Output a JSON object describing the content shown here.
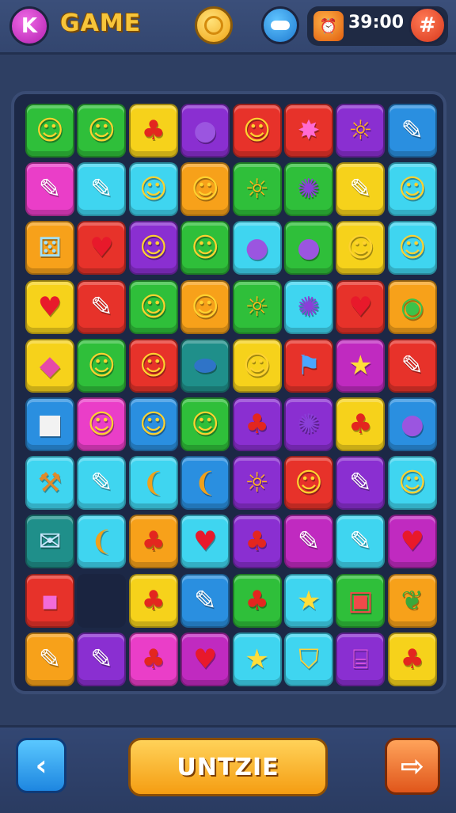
{
  "header": {
    "menu_glyph": "K",
    "title": "GAME",
    "timer": "39:00",
    "grid_glyph": "#",
    "clock_glyph": "⏰",
    "icons": [
      "k-menu-icon",
      "coin-icon",
      "toggle-icon",
      "clock-icon",
      "grid-icon"
    ]
  },
  "footer": {
    "back_glyph": "‹",
    "action_label": "UNTZIE",
    "next_glyph": "⇨"
  },
  "colors": {
    "green": "#2fbf3a",
    "yellow": "#f6d21b",
    "purple": "#8a2fd1",
    "red": "#e7322a",
    "cyan": "#3fd5f0",
    "orange": "#f7a11a",
    "pink": "#ea3ec8",
    "blue": "#2a8fe0",
    "teal": "#1f8f8a",
    "magenta": "#c02ac0"
  },
  "board": {
    "rows": [
      [
        [
          "green",
          "smiley"
        ],
        [
          "green",
          "smiley"
        ],
        [
          "yellow",
          "lollipop"
        ],
        [
          "purple",
          "balloon"
        ],
        [
          "red",
          "smiley"
        ],
        [
          "red",
          "burst"
        ],
        [
          "purple",
          "sun"
        ],
        [
          "blue",
          "pencil"
        ]
      ],
      [
        [
          "pink",
          "pencil"
        ],
        [
          "cyan",
          "pencil"
        ],
        [
          "cyan",
          "smiley"
        ],
        [
          "orange",
          "smiley"
        ],
        [
          "green",
          "sun"
        ],
        [
          "green",
          "monster"
        ],
        [
          "yellow",
          "pencil"
        ],
        [
          "cyan",
          "smiley"
        ]
      ],
      [
        [
          "orange",
          "dice"
        ],
        [
          "red",
          "heart"
        ],
        [
          "purple",
          "smiley"
        ],
        [
          "green",
          "smiley"
        ],
        [
          "cyan",
          "balloon"
        ],
        [
          "green",
          "balloon"
        ],
        [
          "yellow",
          "smiley"
        ],
        [
          "cyan",
          "smiley"
        ]
      ],
      [
        [
          "yellow",
          "heart"
        ],
        [
          "red",
          "pencil"
        ],
        [
          "green",
          "smiley"
        ],
        [
          "orange",
          "smiley"
        ],
        [
          "green",
          "sun"
        ],
        [
          "cyan",
          "monster"
        ],
        [
          "red",
          "heart"
        ],
        [
          "orange",
          "blob"
        ]
      ],
      [
        [
          "yellow",
          "kite"
        ],
        [
          "green",
          "smiley"
        ],
        [
          "red",
          "smiley"
        ],
        [
          "teal",
          "ball"
        ],
        [
          "yellow",
          "smiley"
        ],
        [
          "red",
          "flag"
        ],
        [
          "magenta",
          "star"
        ],
        [
          "red",
          "pencil"
        ]
      ],
      [
        [
          "blue",
          "cube"
        ],
        [
          "pink",
          "smiley"
        ],
        [
          "blue",
          "smiley"
        ],
        [
          "green",
          "smiley"
        ],
        [
          "purple",
          "lollipop"
        ],
        [
          "purple",
          "monster"
        ],
        [
          "yellow",
          "lollipop"
        ],
        [
          "blue",
          "balloon"
        ]
      ],
      [
        [
          "cyan",
          "hammer"
        ],
        [
          "cyan",
          "pencil"
        ],
        [
          "cyan",
          "bean"
        ],
        [
          "blue",
          "bean"
        ],
        [
          "purple",
          "sun"
        ],
        [
          "red",
          "smiley"
        ],
        [
          "purple",
          "pencil"
        ],
        [
          "cyan",
          "smiley"
        ]
      ],
      [
        [
          "teal",
          "envelope"
        ],
        [
          "cyan",
          "bean"
        ],
        [
          "orange",
          "lollipop"
        ],
        [
          "cyan",
          "heart"
        ],
        [
          "purple",
          "lollipop"
        ],
        [
          "magenta",
          "pencil"
        ],
        [
          "cyan",
          "pencil"
        ],
        [
          "magenta",
          "heart"
        ]
      ],
      [
        [
          "red",
          "square"
        ],
        [
          "empty",
          "empty"
        ],
        [
          "yellow",
          "lollipop"
        ],
        [
          "blue",
          "pencil"
        ],
        [
          "green",
          "lollipop"
        ],
        [
          "cyan",
          "star"
        ],
        [
          "green",
          "screen"
        ],
        [
          "orange",
          "leaf"
        ]
      ],
      [
        [
          "orange",
          "pencil"
        ],
        [
          "purple",
          "pencil"
        ],
        [
          "pink",
          "lollipop"
        ],
        [
          "magenta",
          "heart"
        ],
        [
          "cyan",
          "star"
        ],
        [
          "cyan",
          "shield"
        ],
        [
          "purple",
          "cassette"
        ],
        [
          "yellow",
          "lollipop"
        ]
      ]
    ]
  },
  "glyphs": {
    "smiley": "☺",
    "lollipop": "♣",
    "balloon": "●",
    "burst": "✸",
    "sun": "☼",
    "pencil": "✎",
    "monster": "✺",
    "dice": "⚄",
    "heart": "♥",
    "blob": "◉",
    "kite": "◆",
    "ball": "⬬",
    "flag": "⚑",
    "star": "★",
    "cube": "■",
    "hammer": "⚒",
    "bean": "❨",
    "envelope": "✉",
    "square": "▪",
    "screen": "▣",
    "leaf": "❦",
    "shield": "⛉",
    "cassette": "⌸",
    "empty": ""
  },
  "glyph_colors": {
    "smiley": "#ffd230",
    "lollipop": "#e3261f",
    "balloon": "#9b55e0",
    "burst": "#ff6bd3",
    "sun": "#ffb41a",
    "pencil": "#ffffff",
    "monster": "#8a3fd8",
    "dice": "#9fe1ff",
    "heart": "#e8192b",
    "blob": "#3cc24a",
    "kite": "#e64aa8",
    "ball": "#2f74c8",
    "flag": "#4aa6ff",
    "star": "#ffde3a",
    "cube": "#f2f2f2",
    "hammer": "#e08a2a",
    "bean": "#f0a11a",
    "envelope": "#cde8ff",
    "square": "#f26bd8",
    "screen": "#f04a4a",
    "leaf": "#3ca83a",
    "shield": "#ffd23a",
    "cassette": "#e05ad8",
    "empty": "#000000"
  }
}
